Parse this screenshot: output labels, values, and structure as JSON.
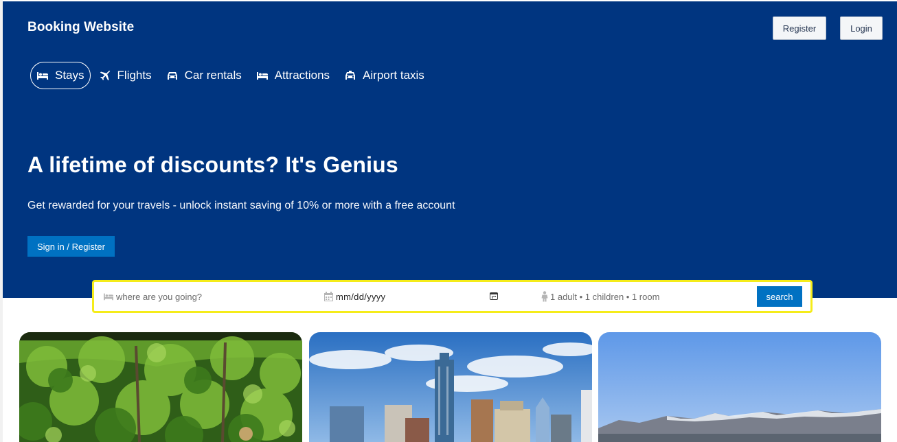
{
  "header": {
    "brand": "Booking Website",
    "register_label": "Register",
    "login_label": "Login"
  },
  "nav": {
    "items": [
      {
        "label": "Stays",
        "icon": "bed-icon",
        "active": true
      },
      {
        "label": "Flights",
        "icon": "plane-icon",
        "active": false
      },
      {
        "label": "Car rentals",
        "icon": "car-icon",
        "active": false
      },
      {
        "label": "Attractions",
        "icon": "bed-icon",
        "active": false
      },
      {
        "label": "Airport taxis",
        "icon": "taxi-icon",
        "active": false
      }
    ]
  },
  "hero": {
    "headline": "A lifetime of discounts? It's Genius",
    "subline": "Get rewarded for your travels - unlock instant saving of 10% or more with a free account",
    "cta_label": "Sign in / Register"
  },
  "search": {
    "destination_placeholder": "where are you going?",
    "date_text": "mm/dd/yyyy",
    "guests_text": "1 adult • 1 children • 1 room",
    "button_label": "search"
  },
  "cards": [
    {
      "image": "forest-photo"
    },
    {
      "image": "city-skyline-photo"
    },
    {
      "image": "mountain-lake-photo"
    }
  ],
  "colors": {
    "hero_bg": "#003580",
    "accent_blue": "#0071c2",
    "search_border": "#f5ec1a"
  }
}
